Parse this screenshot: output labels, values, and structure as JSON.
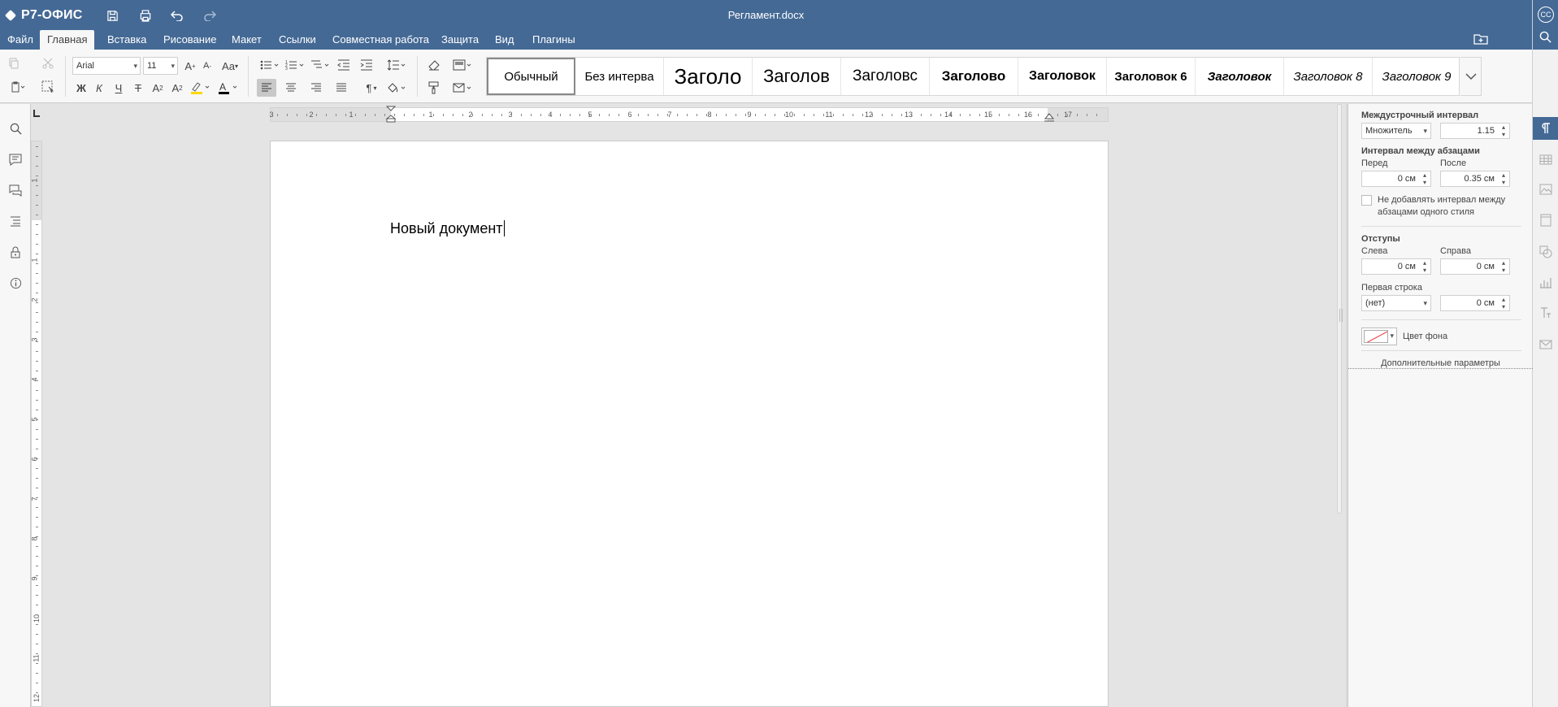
{
  "app": {
    "logo": "Р7-ОФИС",
    "document_title": "Регламент.docx"
  },
  "menu_tabs": [
    "Файл",
    "Главная",
    "Вставка",
    "Рисование",
    "Макет",
    "Ссылки",
    "Совместная работа",
    "Защита",
    "Вид",
    "Плагины"
  ],
  "active_tab": "Главная",
  "user": {
    "initials": "СС"
  },
  "toolbar": {
    "font_name": "Arial",
    "font_size": "11",
    "bold_label": "Ж",
    "italic_label": "К",
    "underline_label": "Ч",
    "strike_label": "Т"
  },
  "styles": [
    "Обычный",
    "Без интерва",
    "Заголо",
    "Заголов",
    "Заголовс",
    "Заголово",
    "Заголовок",
    "Заголовок 6",
    "Заголовок",
    "Заголовок 8",
    "Заголовок 9"
  ],
  "selected_style": "Обычный",
  "ruler": {
    "h_numbers": [
      "3",
      "2",
      "1",
      "1",
      "2",
      "3",
      "4",
      "5",
      "6",
      "7",
      "8",
      "9",
      "10",
      "11",
      "12",
      "13",
      "14",
      "15",
      "16",
      "17"
    ],
    "v_numbers": [
      "1",
      "1",
      "2",
      "3",
      "4",
      "5",
      "6",
      "7",
      "8",
      "9",
      "10",
      "11",
      "12"
    ]
  },
  "document": {
    "text": "Новый документ"
  },
  "paragraph_settings": {
    "line_spacing_title": "Междустрочный интервал",
    "line_spacing_type": "Множитель",
    "line_spacing_value": "1.15",
    "para_spacing_title": "Интервал между абзацами",
    "before_label": "Перед",
    "after_label": "После",
    "before_value": "0 см",
    "after_value": "0.35 см",
    "no_spacing_checkbox_label_1": "Не добавлять интервал между",
    "no_spacing_checkbox_label_2": "абзацами одного стиля",
    "no_spacing_checked": false,
    "indents_title": "Отступы",
    "left_label": "Слева",
    "right_label": "Справа",
    "left_value": "0 см",
    "right_value": "0 см",
    "first_line_label": "Первая строка",
    "first_line_type": "(нет)",
    "first_line_value": "0 см",
    "bg_color_label": "Цвет фона",
    "advanced_link": "Дополнительные параметры"
  },
  "colors": {
    "header": "#446995",
    "panel": "#f7f7f7",
    "canvas": "#e4e4e4",
    "highlight_accent": "#ffd800",
    "font_color_accent": "#000000",
    "no_color_slash": "#ee3333"
  }
}
